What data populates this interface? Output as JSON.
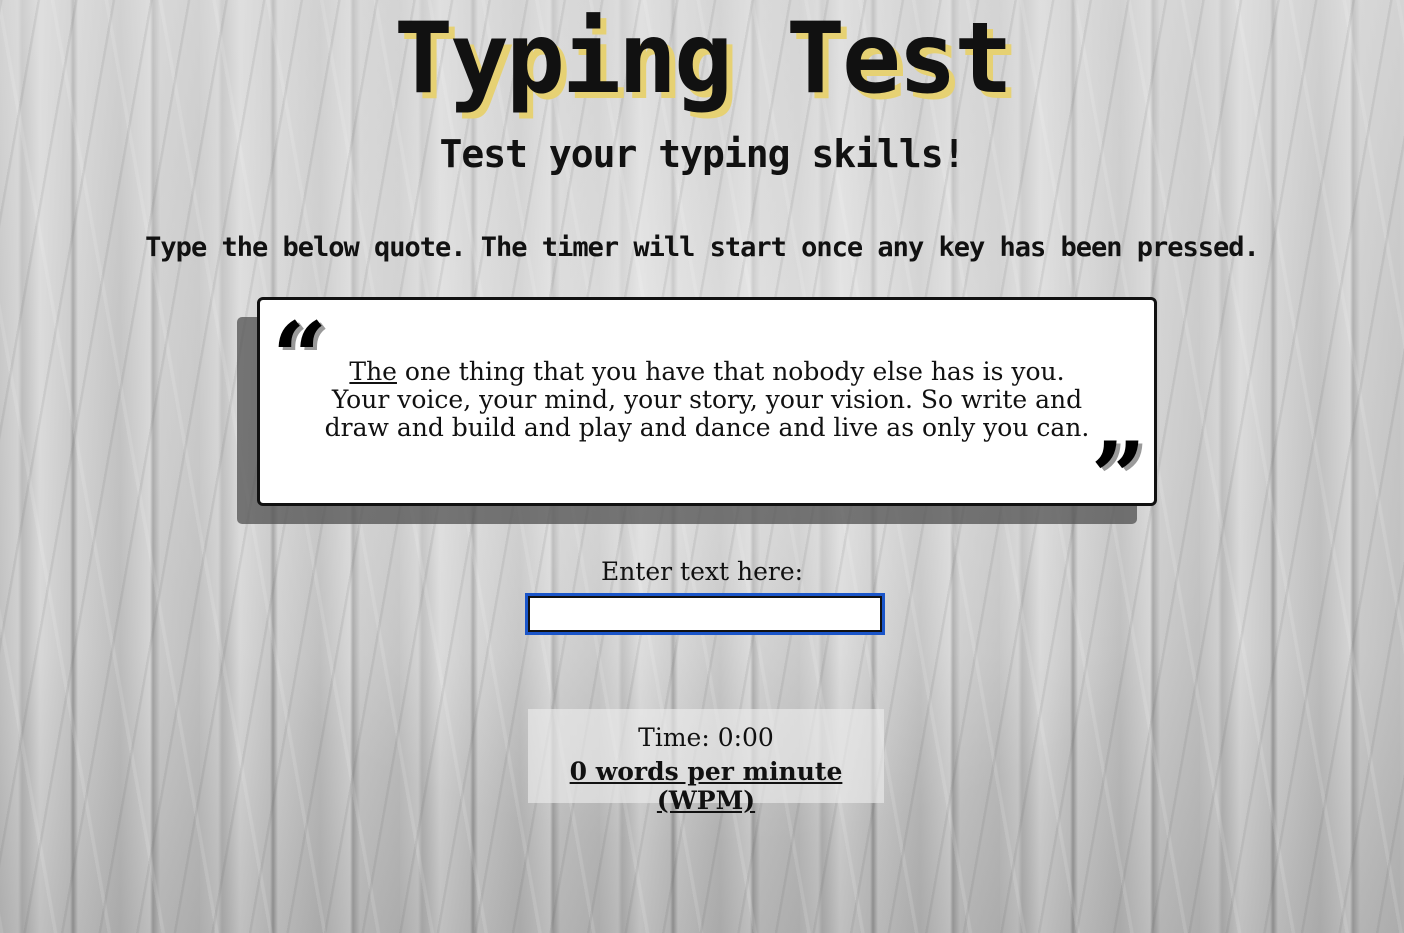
{
  "header": {
    "title": "Typing Test",
    "subtitle": "Test your typing skills!"
  },
  "instructions": "Type the below quote. The timer will start once any key has been pressed.",
  "quote": {
    "open_mark": "“",
    "close_mark": "”",
    "current_word": "The",
    "rest": " one thing that you have that nobody else has is you. Your voice, your mind, your story, your vision. So write and draw and build and play and dance and live as only you can."
  },
  "input": {
    "label": "Enter text here:",
    "value": "",
    "placeholder": ""
  },
  "stats": {
    "time": "Time: 0:00",
    "wpm": "0 words per minute (WPM)"
  },
  "colors": {
    "title_shadow": "#e6d173",
    "input_focus": "#1a55c9",
    "quote_bg": "#ffffff"
  }
}
